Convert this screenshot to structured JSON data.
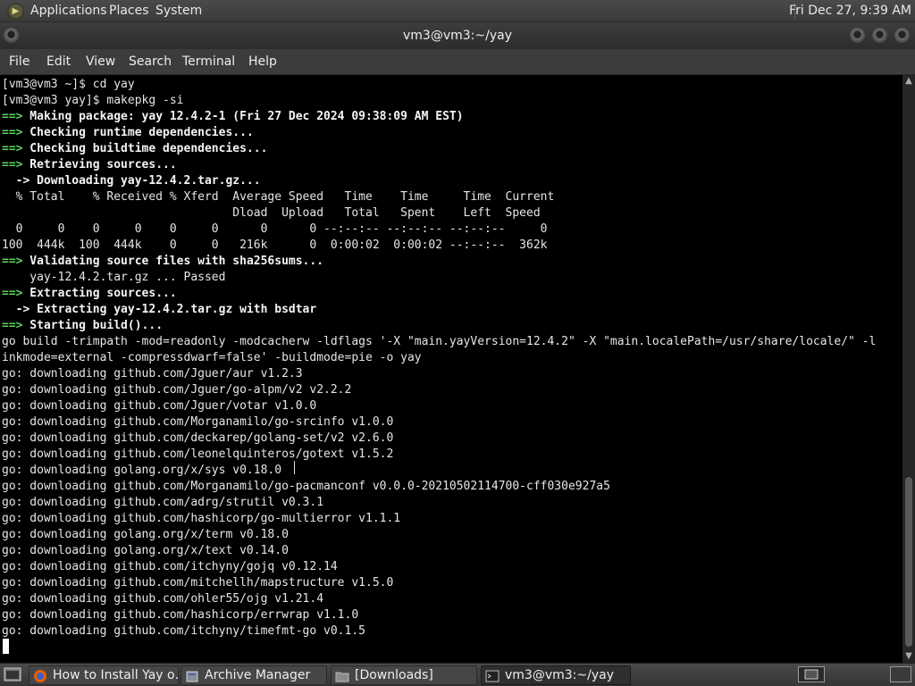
{
  "top_panel": {
    "menus": [
      "Applications",
      "Places",
      "System"
    ],
    "clock": "Fri Dec 27,  9:39 AM"
  },
  "window": {
    "title": "vm3@vm3:~/yay"
  },
  "menubar": [
    "File",
    "Edit",
    "View",
    "Search",
    "Terminal",
    "Help"
  ],
  "terminal": {
    "lines": [
      [
        {
          "t": "[vm3@vm3 ~]$ cd yay"
        }
      ],
      [
        {
          "t": "[vm3@vm3 yay]$ makepkg -si"
        }
      ],
      [
        {
          "t": "==>",
          "c": "arrow"
        },
        {
          "t": " Making package: yay 12.4.2-1 (Fri 27 Dec 2024 09:38:09 AM EST)",
          "c": "bold"
        }
      ],
      [
        {
          "t": "==>",
          "c": "arrow"
        },
        {
          "t": " Checking runtime dependencies...",
          "c": "bold"
        }
      ],
      [
        {
          "t": "==>",
          "c": "arrow"
        },
        {
          "t": " Checking buildtime dependencies...",
          "c": "bold"
        }
      ],
      [
        {
          "t": "==>",
          "c": "arrow"
        },
        {
          "t": " Retrieving sources...",
          "c": "bold"
        }
      ],
      [
        {
          "t": "  -> Downloading yay-12.4.2.tar.gz...",
          "c": "bold"
        }
      ],
      [
        {
          "t": "  % Total    % Received % Xferd  Average Speed   Time    Time     Time  Current"
        }
      ],
      [
        {
          "t": "                                 Dload  Upload   Total   Spent    Left  Speed"
        }
      ],
      [
        {
          "t": "  0     0    0     0    0     0      0      0 --:--:-- --:--:-- --:--:--     0"
        }
      ],
      [
        {
          "t": "100  444k  100  444k    0     0   216k      0  0:00:02  0:00:02 --:--:--  362k"
        }
      ],
      [
        {
          "t": "==>",
          "c": "arrow"
        },
        {
          "t": " Validating source files with sha256sums...",
          "c": "bold"
        }
      ],
      [
        {
          "t": "    yay-12.4.2.tar.gz ... Passed"
        }
      ],
      [
        {
          "t": "==>",
          "c": "arrow"
        },
        {
          "t": " Extracting sources...",
          "c": "bold"
        }
      ],
      [
        {
          "t": "  -> Extracting yay-12.4.2.tar.gz with bsdtar",
          "c": "bold"
        }
      ],
      [
        {
          "t": "==>",
          "c": "arrow"
        },
        {
          "t": " Starting build()...",
          "c": "bold"
        }
      ],
      [
        {
          "t": "go build -trimpath -mod=readonly -modcacherw -ldflags '-X \"main.yayVersion=12.4.2\" -X \"main.localePath=/usr/share/locale/\" -l"
        }
      ],
      [
        {
          "t": "inkmode=external -compressdwarf=false' -buildmode=pie -o yay"
        }
      ],
      [
        {
          "t": "go: downloading github.com/Jguer/aur v1.2.3"
        }
      ],
      [
        {
          "t": "go: downloading github.com/Jguer/go-alpm/v2 v2.2.2"
        }
      ],
      [
        {
          "t": "go: downloading github.com/Jguer/votar v1.0.0"
        }
      ],
      [
        {
          "t": "go: downloading github.com/Morganamilo/go-srcinfo v1.0.0"
        }
      ],
      [
        {
          "t": "go: downloading github.com/deckarep/golang-set/v2 v2.6.0"
        }
      ],
      [
        {
          "t": "go: downloading github.com/leonelquinteros/gotext v1.5.2"
        }
      ],
      [
        {
          "t": "go: downloading golang.org/x/sys v0.18.0"
        }
      ],
      [
        {
          "t": "go: downloading github.com/Morganamilo/go-pacmanconf v0.0.0-20210502114700-cff030e927a5"
        }
      ],
      [
        {
          "t": "go: downloading github.com/adrg/strutil v0.3.1"
        }
      ],
      [
        {
          "t": "go: downloading github.com/hashicorp/go-multierror v1.1.1"
        }
      ],
      [
        {
          "t": "go: downloading golang.org/x/term v0.18.0"
        }
      ],
      [
        {
          "t": "go: downloading golang.org/x/text v0.14.0"
        }
      ],
      [
        {
          "t": "go: downloading github.com/itchyny/gojq v0.12.14"
        }
      ],
      [
        {
          "t": "go: downloading github.com/mitchellh/mapstructure v1.5.0"
        }
      ],
      [
        {
          "t": "go: downloading github.com/ohler55/ojg v1.21.4"
        }
      ],
      [
        {
          "t": "go: downloading github.com/hashicorp/errwrap v1.1.0"
        }
      ],
      [
        {
          "t": "go: downloading github.com/itchyny/timefmt-go v0.1.5"
        }
      ]
    ]
  },
  "taskbar": {
    "tasks": [
      {
        "label": "How to Install Yay o…",
        "icon": "firefox-icon"
      },
      {
        "label": "Archive Manager",
        "icon": "archive-manager-icon"
      },
      {
        "label": "[Downloads]",
        "icon": "folder-icon"
      },
      {
        "label": "vm3@vm3:~/yay",
        "icon": "terminal-icon"
      }
    ]
  },
  "colors": {
    "prompt_arrow": "#5fd35f",
    "terminal_bg": "#000000",
    "terminal_fg": "#e6e6e6",
    "panel_bg": "#3f3f3f"
  }
}
